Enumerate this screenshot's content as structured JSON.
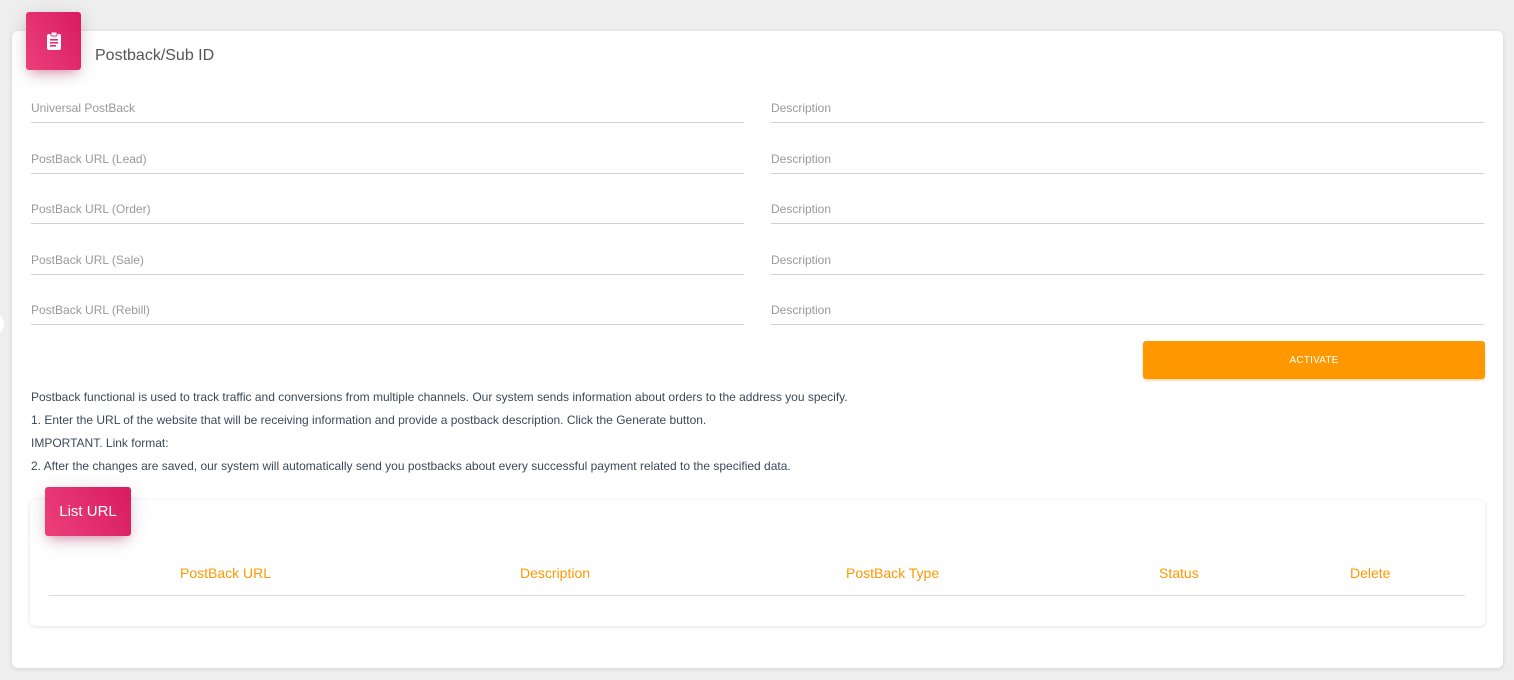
{
  "card": {
    "title": "Postback/Sub ID",
    "icon": "clipboard-icon",
    "accent": "#e91e63"
  },
  "fields": [
    {
      "placeholder": "Universal PostBack",
      "value": "",
      "description_placeholder": "Description",
      "description_value": ""
    },
    {
      "placeholder": "PostBack URL (Lead)",
      "value": "",
      "description_placeholder": "Description",
      "description_value": ""
    },
    {
      "placeholder": "PostBack URL (Order)",
      "value": "",
      "description_placeholder": "Description",
      "description_value": ""
    },
    {
      "placeholder": "PostBack URL (Sale)",
      "value": "",
      "description_placeholder": "Description",
      "description_value": ""
    },
    {
      "placeholder": "PostBack URL (Rebill)",
      "value": "",
      "description_placeholder": "Description",
      "description_value": ""
    }
  ],
  "activate_button": {
    "label": "ACTIVATE",
    "color": "#ff9800"
  },
  "info": [
    "Postback functional is used to track traffic and conversions from multiple channels. Our system sends information about orders to the address you specify.",
    "1. Enter the URL of the website that will be receiving information and provide a postback description. Click the Generate button.",
    "IMPORTANT. Link format:",
    "2. After the changes are saved, our system will automatically send you postbacks about every successful payment related to the specified data."
  ],
  "list": {
    "title": "List URL",
    "columns": [
      "PostBack URL",
      "Description",
      "PostBack Type",
      "Status",
      "Delete"
    ],
    "header_color": "#ff9800",
    "rows": []
  }
}
